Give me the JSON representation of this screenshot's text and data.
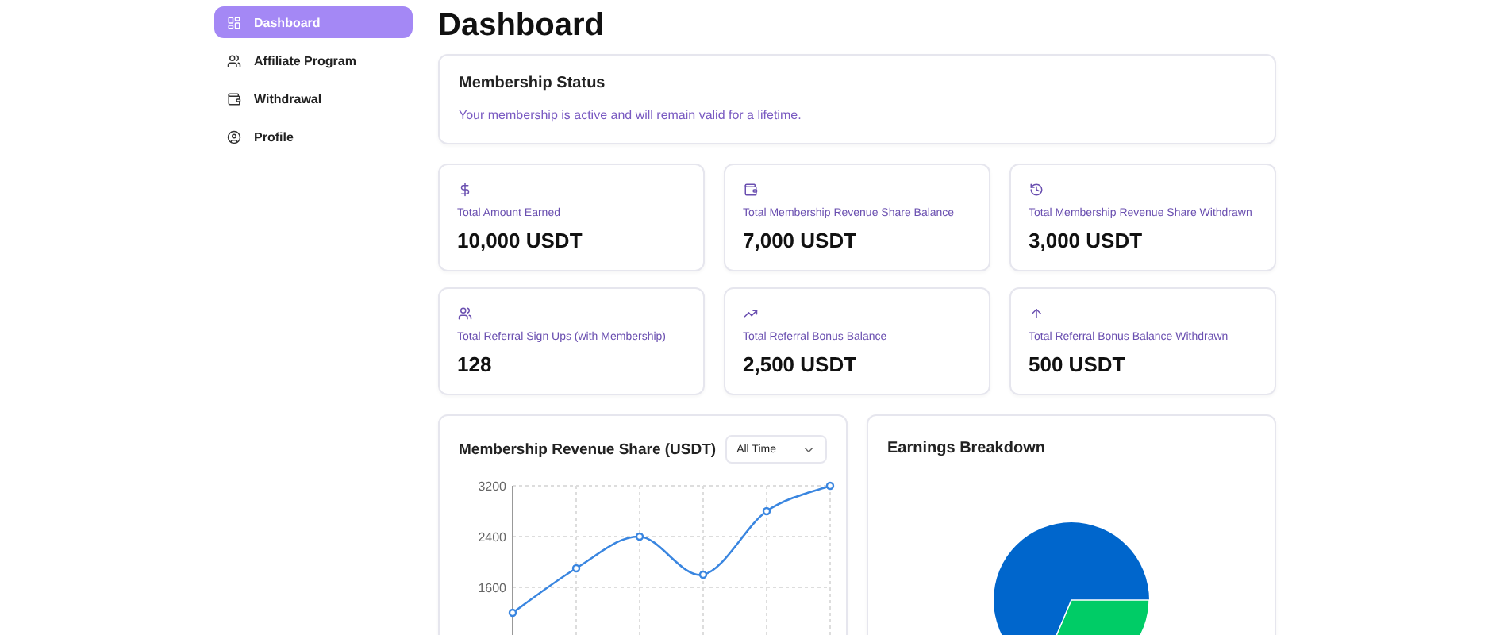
{
  "sidebar": {
    "items": [
      {
        "label": "Dashboard",
        "selected": true
      },
      {
        "label": "Affiliate Program",
        "selected": false
      },
      {
        "label": "Withdrawal",
        "selected": false
      },
      {
        "label": "Profile",
        "selected": false
      }
    ]
  },
  "page_title": "Dashboard",
  "membership_status": {
    "title": "Membership Status",
    "message": "Your membership is active and will remain valid for a lifetime."
  },
  "stats": [
    {
      "label": "Total Amount Earned",
      "value": "10,000 USDT"
    },
    {
      "label": "Total Membership Revenue Share Balance",
      "value": "7,000 USDT"
    },
    {
      "label": "Total Membership Revenue Share Withdrawn",
      "value": "3,000 USDT"
    },
    {
      "label": "Total Referral Sign Ups (with Membership)",
      "value": "128"
    },
    {
      "label": "Total Referral Bonus Balance",
      "value": "2,500 USDT"
    },
    {
      "label": "Total Referral Bonus Balance Withdrawn",
      "value": "500 USDT"
    }
  ],
  "revenue_chart": {
    "title": "Membership Revenue Share (USDT)",
    "period": "All Time",
    "chart_data": {
      "type": "line",
      "grid": true,
      "series": [
        {
          "color": "#3a86e0",
          "marker": true,
          "values": [
            1200,
            1900,
            2400,
            1800,
            2800,
            3200
          ]
        }
      ],
      "ylim": [
        800,
        3200
      ],
      "yticks": [
        1600,
        2400,
        3200
      ]
    }
  },
  "breakdown_chart": {
    "title": "Earnings Breakdown"
  }
}
